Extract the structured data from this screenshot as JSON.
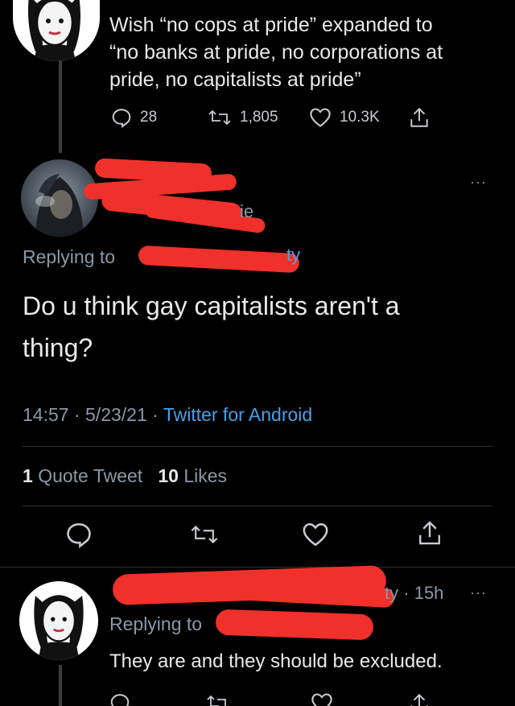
{
  "tweet_top": {
    "text_line1": "Wish “no cops at pride” expanded to",
    "text_line2": "“no banks at pride, no corporations at",
    "text_line3": "pride, no capitalists at pride”",
    "replies": "28",
    "retweets": "1,805",
    "likes": "10.3K"
  },
  "main_tweet": {
    "author_name_visible": "ie",
    "replying_label": "Replying to",
    "replying_handle_visible": "ty",
    "body_line1": "Do u think gay capitalists aren't a",
    "body_line2": "thing?",
    "time": "14:57",
    "sep1": "·",
    "date": "5/23/21",
    "sep2": "·",
    "source": "Twitter for Android",
    "quote_count": "1",
    "quote_label": "Quote Tweet",
    "like_count": "10",
    "like_label": "Likes",
    "more": "···"
  },
  "reply_tweet": {
    "handle_tail": "ty",
    "sep": "·",
    "age": "15h",
    "replying_label": "Replying to",
    "body": "They are and they should be excluded.",
    "more": "···"
  },
  "icons": {
    "reply": "reply-icon",
    "retweet": "retweet-icon",
    "like": "heart-icon",
    "share": "share-icon",
    "more": "more-icon"
  },
  "colors": {
    "background": "#000000",
    "text": "#e7e9ea",
    "muted": "#8b98a5",
    "link": "#4a9fe8",
    "redaction": "#f0302a"
  }
}
